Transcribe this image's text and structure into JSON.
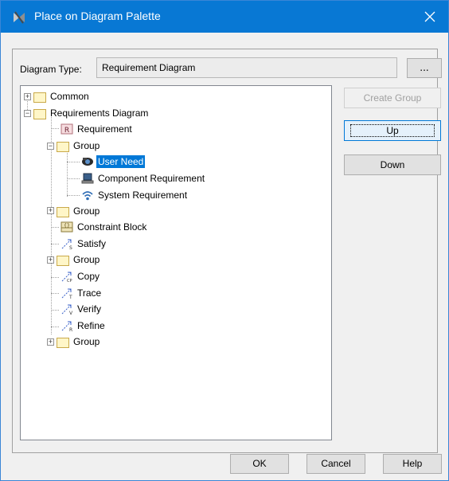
{
  "window": {
    "title": "Place on Diagram Palette",
    "close_glyph": "✕",
    "app_icon": "magicdraw-icon"
  },
  "diagram_type": {
    "label": "Diagram Type:",
    "value": "Requirement Diagram",
    "browse_label": "..."
  },
  "tree": {
    "items": [
      {
        "label": "Common",
        "icon": "folder-icon"
      },
      {
        "label": "Requirements Diagram",
        "icon": "folder-icon"
      },
      {
        "label": "Requirement",
        "icon": "requirement-icon"
      },
      {
        "label": "Group",
        "icon": "folder-icon"
      },
      {
        "label": "User Need",
        "icon": "user-need-icon",
        "selected": true
      },
      {
        "label": "Component Requirement",
        "icon": "laptop-icon"
      },
      {
        "label": "System Requirement",
        "icon": "wifi-icon"
      },
      {
        "label": "Group",
        "icon": "folder-icon"
      },
      {
        "label": "Constraint Block",
        "icon": "constraint-block-icon"
      },
      {
        "label": "Satisfy",
        "icon": "satisfy-icon"
      },
      {
        "label": "Group",
        "icon": "folder-icon"
      },
      {
        "label": "Copy",
        "icon": "copy-icon"
      },
      {
        "label": "Trace",
        "icon": "trace-icon"
      },
      {
        "label": "Verify",
        "icon": "verify-icon"
      },
      {
        "label": "Refine",
        "icon": "refine-icon"
      },
      {
        "label": "Group",
        "icon": "folder-icon"
      }
    ]
  },
  "side_buttons": {
    "create_group": "Create Group",
    "up": "Up",
    "down": "Down"
  },
  "bottom_buttons": {
    "ok": "OK",
    "cancel": "Cancel",
    "help": "Help"
  },
  "colors": {
    "titlebar": "#0878d4",
    "selection": "#0078d7"
  }
}
